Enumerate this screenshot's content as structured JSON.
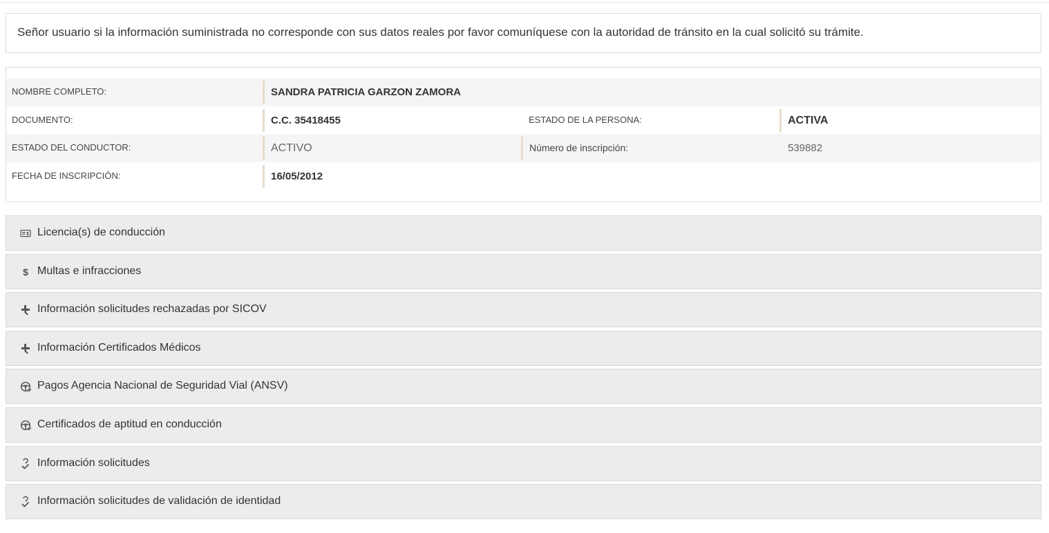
{
  "notice": {
    "text": "Señor usuario si la información suministrada no corresponde con sus datos reales por favor comuníquese con la autoridad de tránsito en la cual solicitó su trámite."
  },
  "person": {
    "nombre_label": "NOMBRE COMPLETO:",
    "nombre_value": "SANDRA PATRICIA GARZON ZAMORA",
    "documento_label": "DOCUMENTO:",
    "documento_value": "C.C. 35418455",
    "estado_persona_label": "ESTADO DE LA PERSONA:",
    "estado_persona_value": "ACTIVA",
    "estado_conductor_label": "ESTADO DEL CONDUCTOR:",
    "estado_conductor_value": "ACTIVO",
    "inscripcion_label": "Número de inscripción:",
    "inscripcion_value": "539882",
    "fecha_label": "FECHA DE INSCRIPCIÓN:",
    "fecha_value": "16/05/2012"
  },
  "sections": [
    {
      "label": "Licencia(s) de conducción",
      "icon": "id-card-icon"
    },
    {
      "label": "Multas e infracciones",
      "icon": "dollar-icon"
    },
    {
      "label": "Información solicitudes rechazadas por SICOV",
      "icon": "medical-cross-icon"
    },
    {
      "label": "Información Certificados Médicos",
      "icon": "medical-cross-icon"
    },
    {
      "label": "Pagos Agencia Nacional de Seguridad Vial (ANSV)",
      "icon": "steering-wheel-icon"
    },
    {
      "label": "Certificados de aptitud en conducción",
      "icon": "steering-wheel-icon"
    },
    {
      "label": "Información solicitudes",
      "icon": "question-check-icon"
    },
    {
      "label": "Información solicitudes de validación de identidad",
      "icon": "question-check-icon"
    }
  ]
}
